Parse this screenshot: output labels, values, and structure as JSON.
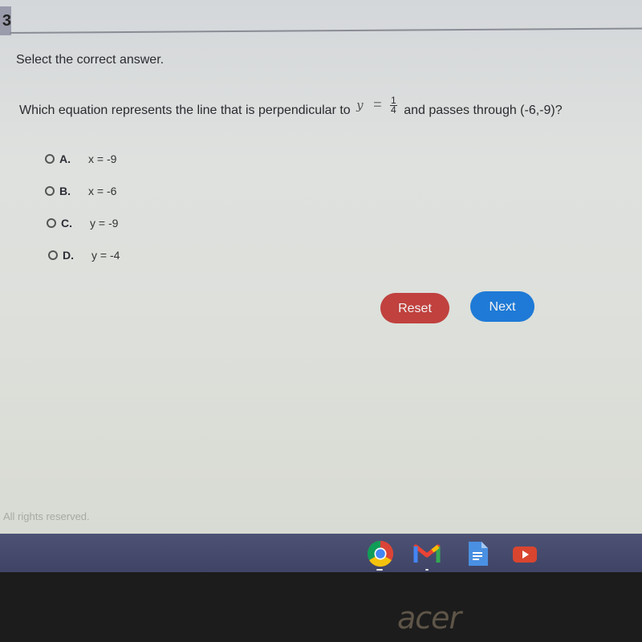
{
  "question_number": "3",
  "instruction": "Select the correct answer.",
  "question": {
    "prefix": "Which equation represents the line that is perpendicular to",
    "equation_var": "y",
    "equation_eq": "=",
    "fraction_num": "1",
    "fraction_den": "4",
    "suffix": "and passes through (-6,-9)?"
  },
  "options": [
    {
      "letter": "A.",
      "text": "x = -9",
      "selected": false
    },
    {
      "letter": "B.",
      "text": "x = -6",
      "selected": false
    },
    {
      "letter": "C.",
      "text": "y = -9",
      "selected": false
    },
    {
      "letter": "D.",
      "text": "y = -4",
      "selected": false
    }
  ],
  "buttons": {
    "reset": "Reset",
    "next": "Next"
  },
  "colors": {
    "reset": "#c0413e",
    "next": "#1e7ad6"
  },
  "footer": "All rights reserved.",
  "taskbar": {
    "apps": [
      "chrome-icon",
      "gmail-icon",
      "docs-icon",
      "youtube-icon"
    ]
  },
  "brand": "acer"
}
